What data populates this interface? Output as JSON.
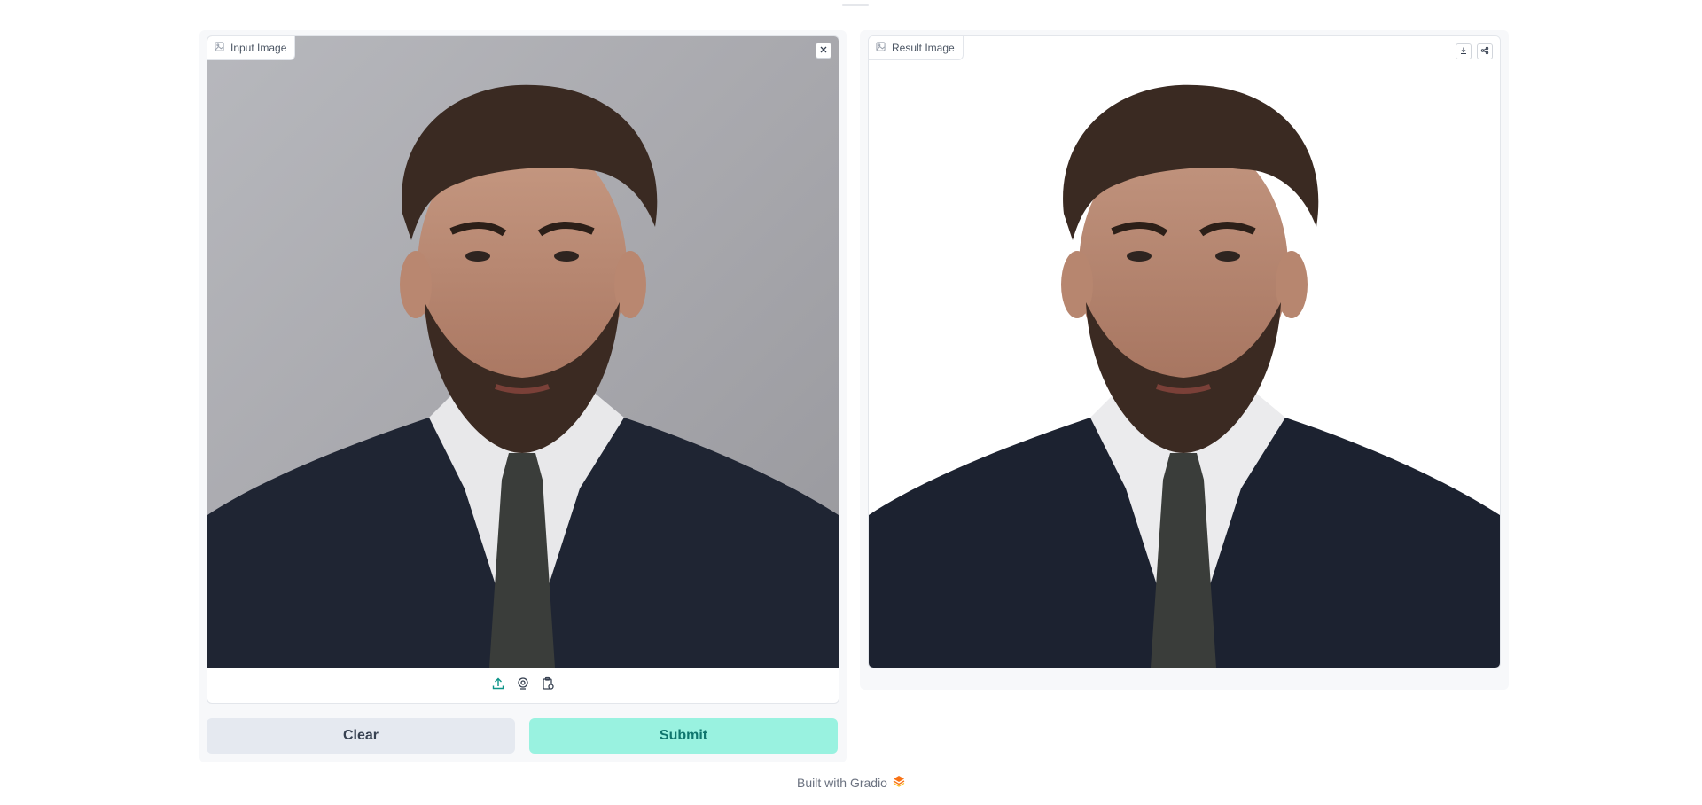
{
  "input_panel": {
    "label": "Input Image",
    "image_icon": "image-icon",
    "clear_icon": "close-icon",
    "sources": [
      "upload-icon",
      "webcam-icon",
      "clipboard-icon"
    ],
    "clear_label": "Clear",
    "submit_label": "Submit"
  },
  "result_panel": {
    "label": "Result Image",
    "image_icon": "image-icon",
    "actions": [
      "download-icon",
      "share-icon"
    ]
  },
  "footer": {
    "text": "Built with Gradio",
    "logo_icon": "gradio-logo-icon"
  },
  "colors": {
    "accent": "#0d9488",
    "submit_bg": "#99f2e0",
    "clear_bg": "#e5e9f0",
    "gradio_orange": "#f97316"
  }
}
